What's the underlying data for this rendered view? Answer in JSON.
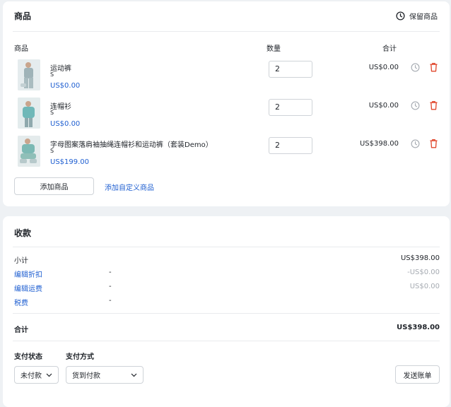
{
  "products": {
    "title": "商品",
    "keep_label": "保留商品",
    "columns": {
      "product": "商品",
      "qty": "数量",
      "total": "合计"
    },
    "items": [
      {
        "name": "运动裤",
        "variant": "S",
        "price": "US$0.00",
        "qty": "2",
        "total": "US$0.00"
      },
      {
        "name": "连帽衫",
        "variant": "S",
        "price": "US$0.00",
        "qty": "2",
        "total": "US$0.00"
      },
      {
        "name": "字母图案落肩袖抽绳连帽衫和运动裤（套装Demo）",
        "variant": "S",
        "price": "US$199.00",
        "qty": "2",
        "total": "US$398.00"
      }
    ],
    "add_product": "添加商品",
    "add_custom": "添加自定义商品"
  },
  "payment": {
    "title": "收款",
    "subtotal_label": "小计",
    "subtotal_value": "US$398.00",
    "discount_label": "编辑折扣",
    "discount_dash": "-",
    "discount_value": "-US$0.00",
    "shipping_label": "编辑运费",
    "shipping_dash": "-",
    "shipping_value": "US$0.00",
    "tax_label": "税费",
    "tax_dash": "-",
    "total_label": "合计",
    "total_value": "US$398.00",
    "status_label": "支付状态",
    "method_label": "支付方式",
    "status_value": "未付款",
    "method_value": "货到付款",
    "send_invoice": "发送账单"
  },
  "colors": {
    "link": "#1f5fd1",
    "delete": "#e0462b",
    "muted": "#a6abb2"
  }
}
